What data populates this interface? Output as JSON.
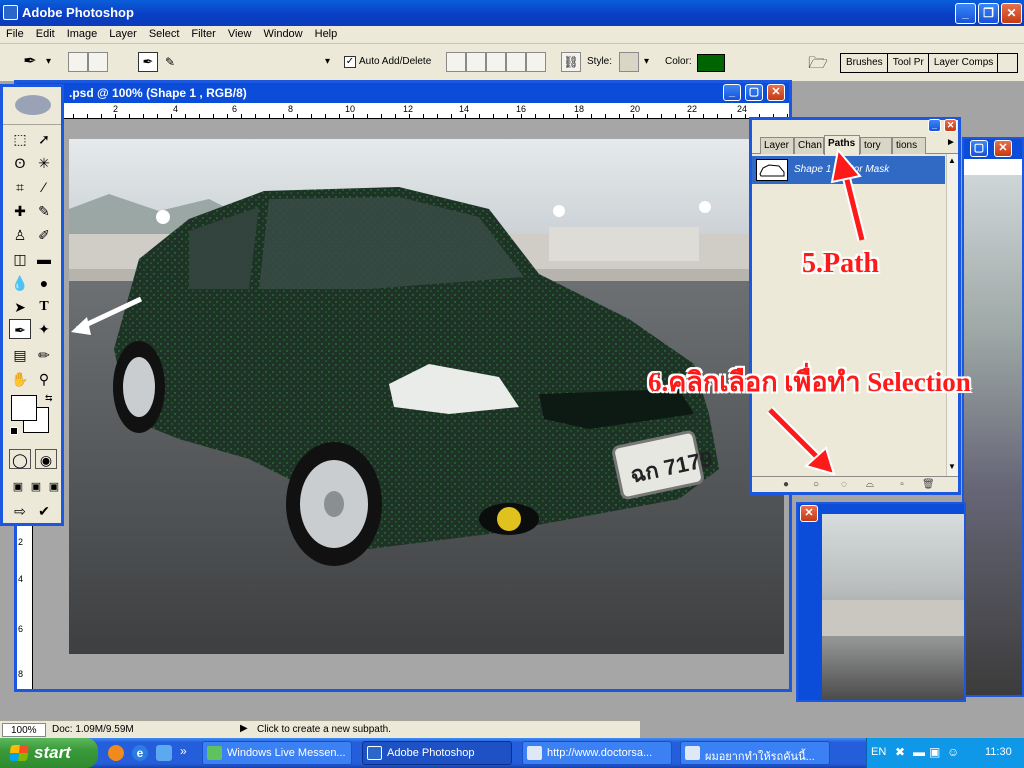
{
  "window": {
    "title": "Adobe Photoshop",
    "minimize": "_",
    "restore": "❐",
    "close": "✕"
  },
  "menu": [
    "File",
    "Edit",
    "Image",
    "Layer",
    "Select",
    "Filter",
    "View",
    "Window",
    "Help"
  ],
  "options": {
    "auto_add_delete_label": "Auto Add/Delete",
    "auto_add_delete_checked": true,
    "style_label": "Style:",
    "color_label": "Color:",
    "color_value": "#006400",
    "well_tabs": [
      "Brushes",
      "Tool Pr",
      "Layer Comps"
    ]
  },
  "document": {
    "title": ".psd @ 100% (Shape 1 , RGB/8)",
    "ruler_top": [
      "2",
      "4",
      "6",
      "8",
      "10",
      "12",
      "14",
      "16",
      "18",
      "20",
      "22",
      "24"
    ],
    "ruler_left": [
      "2",
      "4",
      "6",
      "8"
    ]
  },
  "panel": {
    "tabs": [
      "Layer",
      "Chan",
      "Paths",
      "tory",
      "tions"
    ],
    "active_tab": "Paths",
    "path_item": "Shape 1 Vector Mask"
  },
  "annotations": {
    "step5": "5.Path",
    "step6": "6.คลิกเลือก เพื่อทำ Selection"
  },
  "status": {
    "zoom": "100%",
    "doc": "Doc: 1.09M/9.59M",
    "hint": "Click to create a new subpath."
  },
  "taskbar": {
    "start": "start",
    "items": [
      "Windows Live Messen...",
      "Adobe Photoshop",
      "http://www.doctorsa...",
      "ผมอยากทำให้รถคันนี้..."
    ],
    "active_item": "Adobe Photoshop",
    "lang": "EN",
    "time": "11:30"
  },
  "colors": {
    "accent": "#0b4cd8",
    "chrome": "#ece9d8",
    "annotation": "#ff1a1a",
    "car_paint": "#1e3228"
  }
}
